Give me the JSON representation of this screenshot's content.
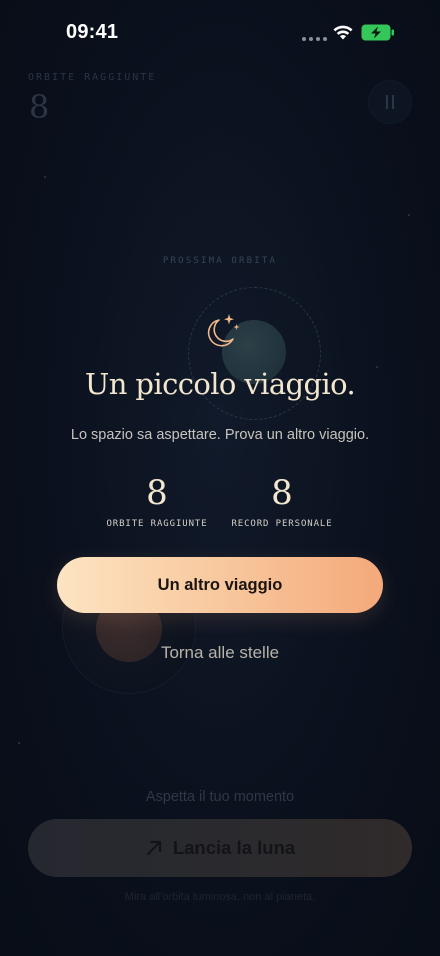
{
  "status_bar": {
    "time": "09:41"
  },
  "game": {
    "orbits_label": "ORBITE RAGGIUNTE",
    "orbits_value": "8",
    "next_orbit_label": "PROSSIMA ORBITA",
    "wait_text": "Aspetta il tuo momento",
    "launch_label": "Lancia la luna",
    "hint_text": "Mira all'orbita luminosa, non al pianeta."
  },
  "dialog": {
    "icon": "moon-stars-icon",
    "title": "Un piccolo viaggio.",
    "subtitle": "Lo spazio sa aspettare. Prova un altro viaggio.",
    "stats": {
      "orbits": {
        "value": "8",
        "label": "ORBITE RAGGIUNTE"
      },
      "record": {
        "value": "8",
        "label": "RECORD PERSONALE"
      }
    },
    "retry_label": "Un altro viaggio",
    "back_label": "Torna alle stelle"
  },
  "colors": {
    "background": "#0a101c",
    "accent_gradient_start": "#fde4c2",
    "accent_gradient_end": "#f4a97a",
    "title": "#f3e6cf",
    "battery": "#35c759"
  }
}
